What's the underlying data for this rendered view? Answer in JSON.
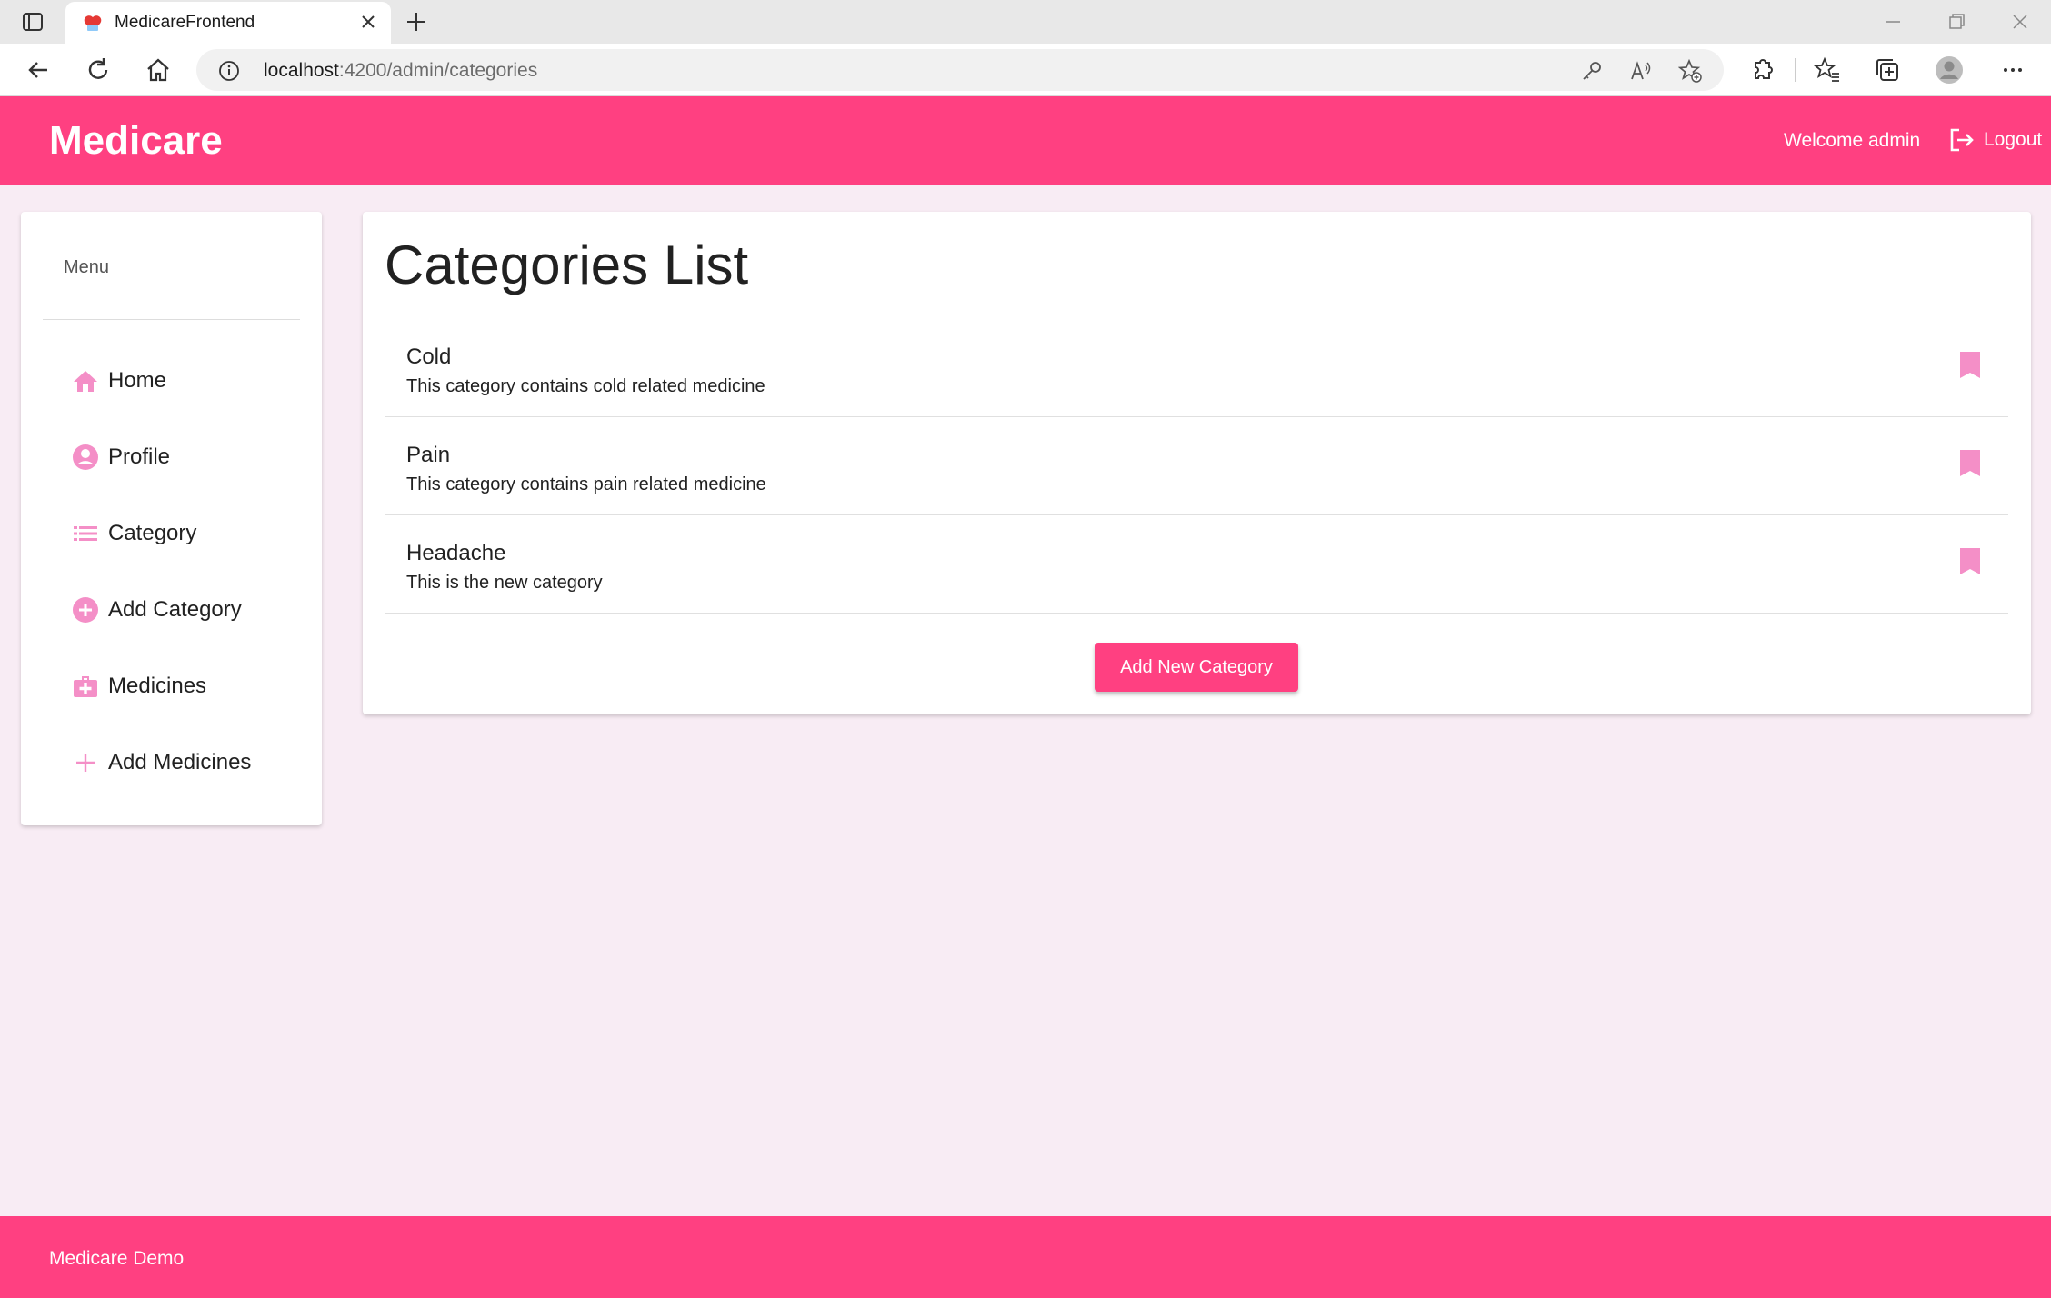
{
  "browser": {
    "tab_title": "MedicareFrontend",
    "url_host": "localhost",
    "url_path": ":4200/admin/categories"
  },
  "header": {
    "brand": "Medicare",
    "welcome": "Welcome admin",
    "logout_label": "Logout"
  },
  "sidebar": {
    "heading": "Menu",
    "items": [
      {
        "label": "Home",
        "icon": "home-icon"
      },
      {
        "label": "Profile",
        "icon": "account-circle-icon"
      },
      {
        "label": "Category",
        "icon": "list-icon"
      },
      {
        "label": "Add Category",
        "icon": "add-circle-icon"
      },
      {
        "label": "Medicines",
        "icon": "medical-bag-icon"
      },
      {
        "label": "Add Medicines",
        "icon": "plus-icon"
      }
    ]
  },
  "main": {
    "title": "Categories List",
    "categories": [
      {
        "name": "Cold",
        "description": "This category contains cold related medicine"
      },
      {
        "name": "Pain",
        "description": "This category contains pain related medicine"
      },
      {
        "name": "Headache",
        "description": "This is the new category"
      }
    ],
    "add_button_label": "Add New Category"
  },
  "footer": {
    "text": "Medicare Demo"
  },
  "colors": {
    "primary": "#ff4081",
    "icon_accent": "#f48fc7",
    "background": "#f8ecf4"
  }
}
